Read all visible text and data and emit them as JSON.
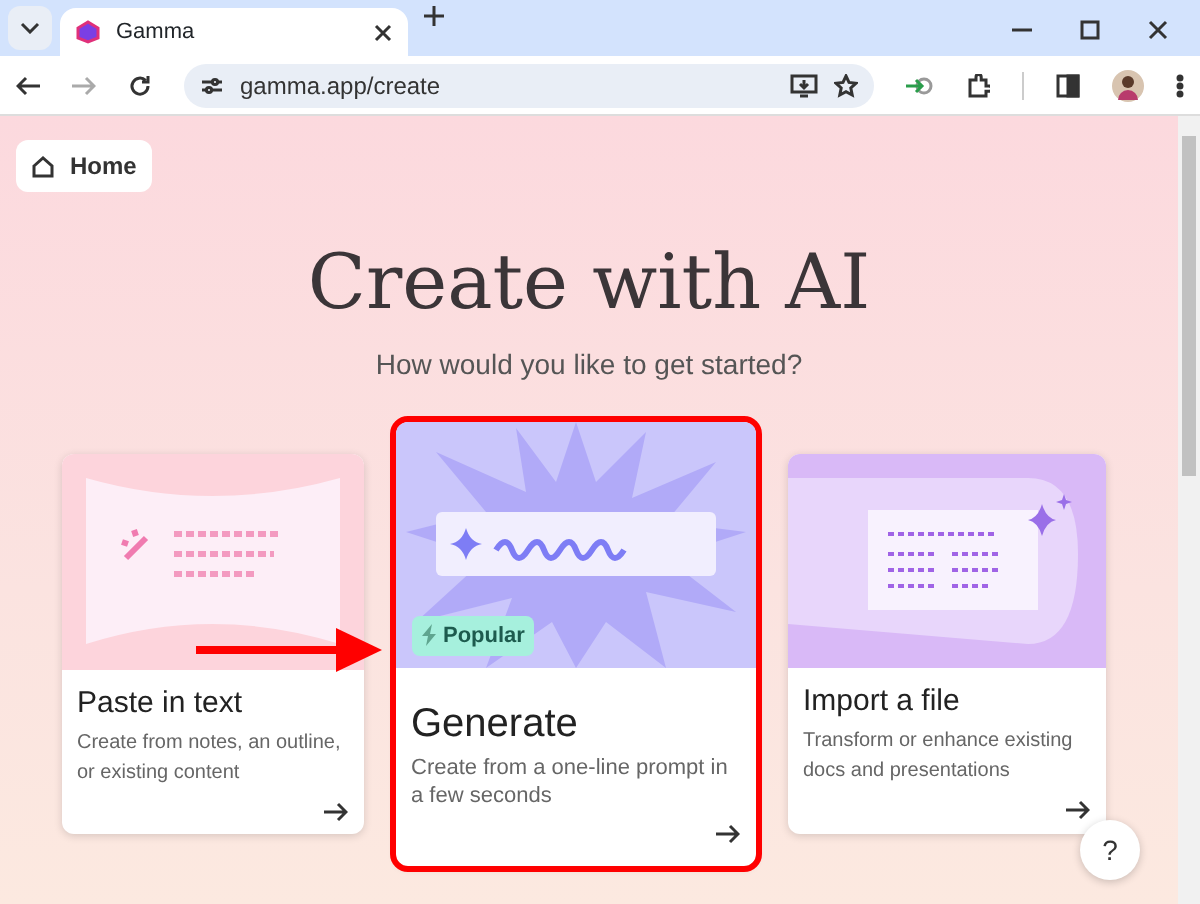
{
  "browser": {
    "tab_title": "Gamma",
    "url": "gamma.app/create"
  },
  "home_button": {
    "label": "Home"
  },
  "title": "Create with AI",
  "subtitle": "How would you like to get started?",
  "cards": [
    {
      "kind": "paste",
      "title": "Paste in text",
      "description": "Create from notes, an outline, or existing content",
      "highlighted": false
    },
    {
      "kind": "generate",
      "title": "Generate",
      "description": "Create from a one-line prompt in a few seconds",
      "badge": "Popular",
      "highlighted": true
    },
    {
      "kind": "import",
      "title": "Import a file",
      "description": "Transform or enhance existing docs and presentations",
      "highlighted": false
    }
  ],
  "help_button": {
    "label": "?"
  }
}
